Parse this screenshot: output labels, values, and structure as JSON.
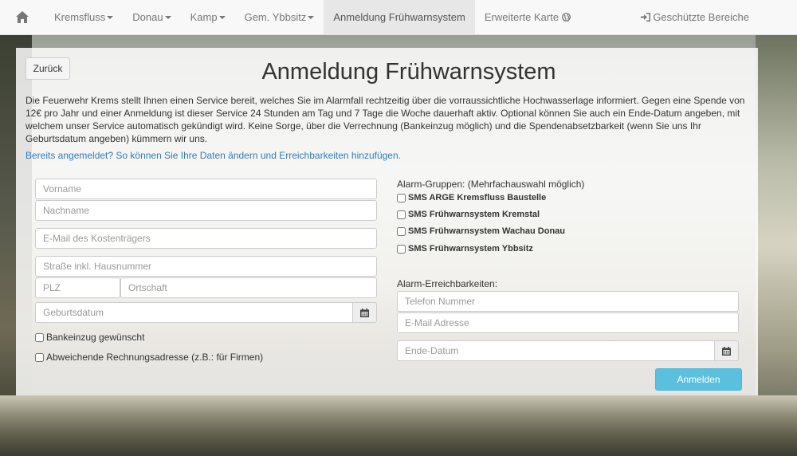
{
  "navbar": {
    "home_icon": "home-icon",
    "items": [
      {
        "label": "Kremsfluss",
        "dropdown": true
      },
      {
        "label": "Donau",
        "dropdown": true
      },
      {
        "label": "Kamp",
        "dropdown": true
      },
      {
        "label": "Gem. Ybbsitz",
        "dropdown": true
      },
      {
        "label": "Anmeldung Frühwarnsystem",
        "active": true
      },
      {
        "label": "Erweiterte Karte",
        "icon": "globe-icon"
      }
    ],
    "right_label": "Geschützte Bereiche",
    "right_icon": "login-icon"
  },
  "page": {
    "back_label": "Zurück",
    "title": "Anmeldung Frühwarnsystem",
    "intro": "Die Feuerwehr Krems stellt Ihnen einen Service bereit, welches Sie im Alarmfall rechtzeitig über die vorraussichtliche Hochwasserlage informiert. Gegen eine Spende von 12€ pro Jahr und einer Anmeldung ist dieser Service 24 Stunden am Tag und 7 Tage die Woche dauerhaft aktiv. Optional können Sie auch ein Ende-Datum angeben, mit welchem unser Service automatisch gekündigt wird. Keine Sorge, über die Verrechnung (Bankeinzug möglich) und die Spendenabsetzbarkeit (wenn Sie uns Ihr Geburtsdatum angeben) kümmern wir uns.",
    "already_link": "Bereits angemeldet? So können Sie Ihre Daten ändern und Erreichbarkeiten hinzufügen."
  },
  "form": {
    "firstname_ph": "Vorname",
    "lastname_ph": "Nachname",
    "email_payer_ph": "E-Mail des Kostenträgers",
    "street_ph": "Straße inkl. Hausnummer",
    "zip_ph": "PLZ",
    "city_ph": "Ortschaft",
    "birthdate_ph": "Geburtsdatum",
    "bank_label": "Bankeinzug gewünscht",
    "billing_label": "Abweichende Rechnungsadresse (z.B.: für Firmen)",
    "groups_label": "Alarm-Gruppen: (Mehrfachauswahl möglich)",
    "groups": [
      "SMS ARGE Kremsfluss Baustelle",
      "SMS Frühwarnsystem Kremstal",
      "SMS Frühwarnsystem Wachau Donau",
      "SMS Frühwarnsystem Ybbsitz"
    ],
    "contacts_label": "Alarm-Erreichbarkeiten:",
    "phone_ph": "Telefon Nummer",
    "email_ph": "E-Mail Adresse",
    "enddate_ph": "Ende-Datum",
    "submit_label": "Anmelden",
    "calendar_icon": "calendar-icon"
  }
}
